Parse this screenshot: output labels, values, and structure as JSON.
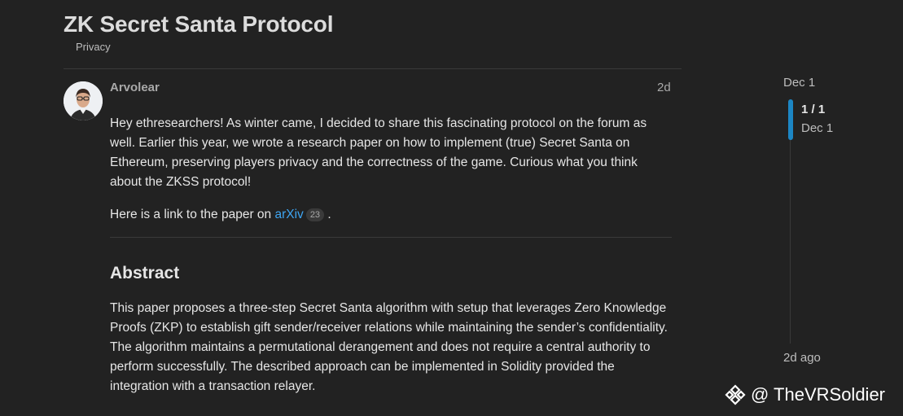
{
  "topic": {
    "title": "ZK Secret Santa Protocol",
    "category": "Privacy"
  },
  "post": {
    "username": "Arvolear",
    "age": "2d",
    "paragraph1": "Hey ethresearchers! As winter came, I decided to share this fascinating protocol on the forum as well. Earlier this year, we wrote a research paper on how to implement (true) Secret Santa on Ethereum, preserving players privacy and the correctness of the game. Curious what you think about the ZKSS protocol!",
    "link_prefix": "Here is a link to the paper on ",
    "link_text": "arXiv",
    "link_clicks": "23",
    "link_suffix": " .",
    "abstract_heading": "Abstract",
    "abstract_text": "This paper proposes a three-step Secret Santa algorithm with setup that leverages Zero Knowledge Proofs (ZKP) to establish gift sender/receiver relations while maintaining the sender’s confidentiality. The algorithm maintains a permutational derangement and does not require a central authority to perform successfully. The described approach can be implemented in Solidity provided the integration with a transaction relayer."
  },
  "timeline": {
    "start_date": "Dec 1",
    "progress": "1 / 1",
    "handle_date": "Dec 1",
    "end_label": "2d ago"
  },
  "watermark": {
    "text": "@ TheVRSoldier"
  },
  "colors": {
    "background": "#222222",
    "link": "#3ea5f2",
    "timeline_accent": "#1c86c4"
  },
  "icons": {
    "avatar": "user-avatar",
    "watermark_logo": "binance-logo-icon"
  }
}
